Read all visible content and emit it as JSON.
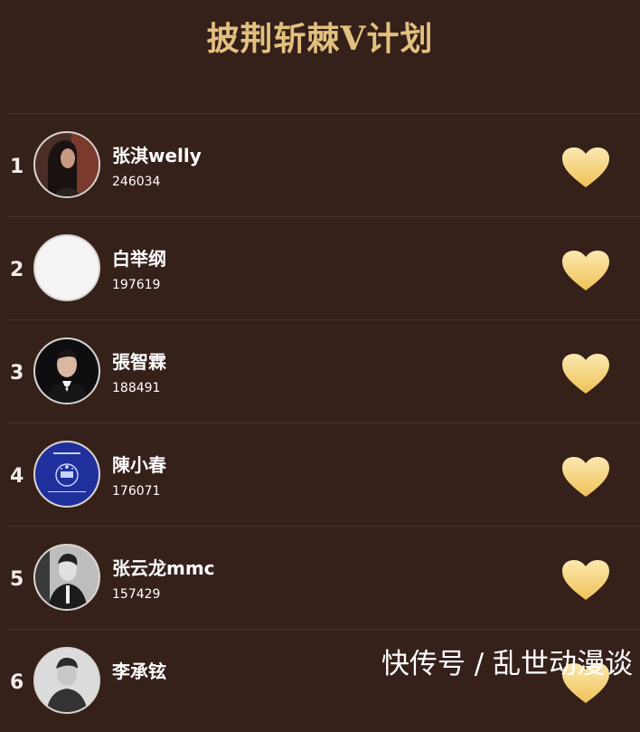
{
  "page": {
    "title": "披荆斩棘V计划"
  },
  "ranking": [
    {
      "rank": "1",
      "name": "张淇welly",
      "score": "246034",
      "avatar": "photo-person-long-hair"
    },
    {
      "rank": "2",
      "name": "白举纲",
      "score": "197619",
      "avatar": "blank"
    },
    {
      "rank": "3",
      "name": "張智霖",
      "score": "188491",
      "avatar": "photo-man-suit"
    },
    {
      "rank": "4",
      "name": "陳小春",
      "score": "176071",
      "avatar": "hong-kong-passport"
    },
    {
      "rank": "5",
      "name": "张云龙mmc",
      "score": "157429",
      "avatar": "photo-man-black-white"
    },
    {
      "rank": "6",
      "name": "李承铉",
      "score": "",
      "avatar": "photo-man-black-white"
    }
  ],
  "like_icon": "heart-icon",
  "colors": {
    "background": "#35201a",
    "title_gold": "#e2c17f",
    "heart_gold": "#f4cf6e"
  },
  "watermark": {
    "text": "快传号 / 乱世动漫谈"
  }
}
